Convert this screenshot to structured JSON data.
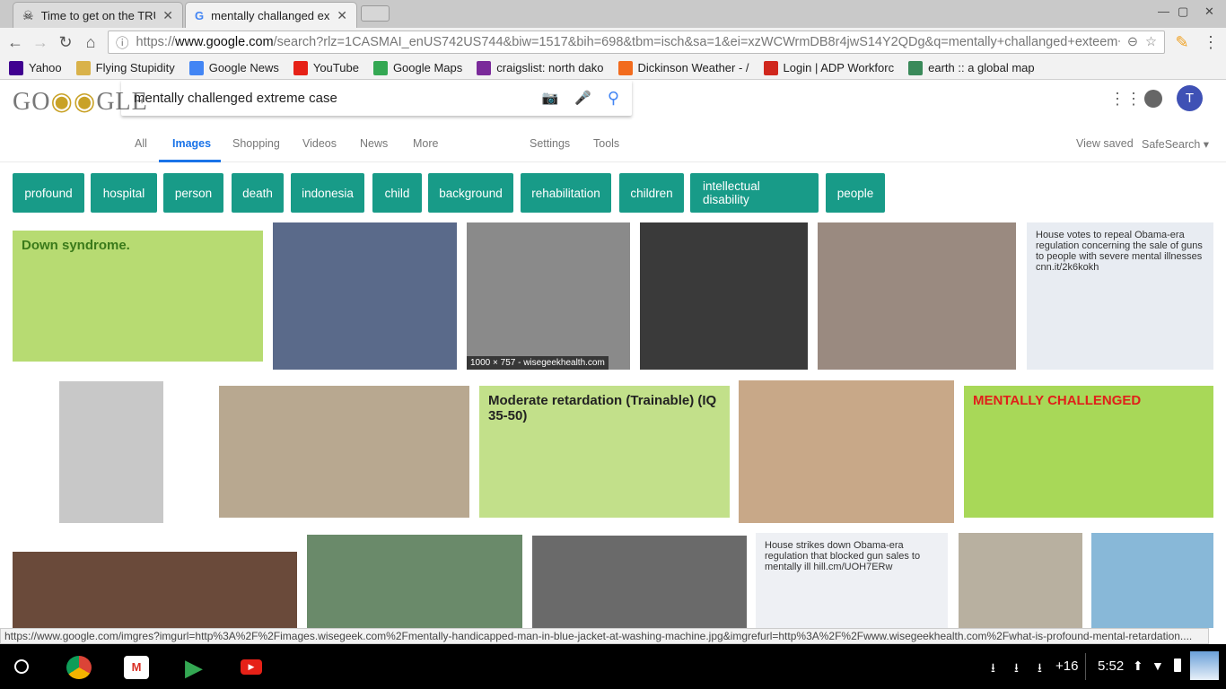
{
  "tabs": [
    {
      "title": "Time to get on the TRUM",
      "icon": "skull-crossbones-icon"
    },
    {
      "title": "mentally challanged exte",
      "icon": "google-g-icon"
    }
  ],
  "omnibox": {
    "scheme": "https://",
    "host": "www.google.com",
    "path": "/search?rlz=1CASMAI_enUS742US744&biw=1517&bih=698&tbm=isch&sa=1&ei=xzWCWrmDB8r4jwS14Y2QDg&q=mentally+challanged+exteem+cas..."
  },
  "bookmarks": [
    {
      "label": "Yahoo",
      "color": "#400090"
    },
    {
      "label": "Flying Stupidity",
      "color": "#d9b24a"
    },
    {
      "label": "Google News",
      "color": "#4285f4"
    },
    {
      "label": "YouTube",
      "color": "#e62117"
    },
    {
      "label": "Google Maps",
      "color": "#34a853"
    },
    {
      "label": "craigslist: north dako",
      "color": "#7a2a9a"
    },
    {
      "label": "Dickinson Weather - /",
      "color": "#f26b1d"
    },
    {
      "label": "Login | ADP Workforc",
      "color": "#d0271d"
    },
    {
      "label": "earth :: a global map",
      "color": "#3a8a5a"
    }
  ],
  "google": {
    "logo": "GOOGLE",
    "query": "mentally challenged extreme case",
    "account_initial": "T"
  },
  "nav": {
    "tabs": [
      "All",
      "Images",
      "Shopping",
      "Videos",
      "News",
      "More"
    ],
    "settings": "Settings",
    "tools": "Tools",
    "view_saved": "View saved",
    "safesearch": "SafeSearch ▾"
  },
  "chips": [
    "profound",
    "hospital",
    "person",
    "death",
    "indonesia",
    "child",
    "background",
    "rehabilitation",
    "children",
    "intellectual disability",
    "people"
  ],
  "images": [
    {
      "c": "#b7db72",
      "t": "Down syndrome.",
      "tc": "#3a7a1a"
    },
    {
      "c": "#5a6a8a",
      "t": ""
    },
    {
      "c": "#8a8a8a",
      "t": "",
      "cap": "1000 × 757 - wisegeekhealth.com"
    },
    {
      "c": "#3a3a3a",
      "t": ""
    },
    {
      "c": "#9a8a80",
      "t": ""
    },
    {
      "c": "#e8ecf2",
      "t": "House votes to repeal Obama-era regulation concerning the sale of guns to people with severe mental illnesses cnn.it/2k6kokh",
      "tc": "#333",
      "small": true
    },
    {
      "c": "#c8c8c8",
      "t": ""
    },
    {
      "c": "#b8a890",
      "t": ""
    },
    {
      "c": "#c2e08a",
      "t": "Moderate retardation (Trainable) (IQ 35-50)",
      "tc": "#222"
    },
    {
      "c": "#c8a888",
      "t": ""
    },
    {
      "c": "#a8d858",
      "t": "MENTALLY CHALLENGED",
      "tc": "#e0201a"
    },
    {
      "c": "#6a4a3a",
      "t": ""
    },
    {
      "c": "#6a8a6a",
      "t": ""
    },
    {
      "c": "#6a6a6a",
      "t": ""
    },
    {
      "c": "#eef0f4",
      "t": "House strikes down Obama-era regulation that blocked gun sales to mentally ill hill.cm/UOH7ERw",
      "tc": "#333",
      "small": true
    },
    {
      "c": "#b8b0a0",
      "t": ""
    },
    {
      "c": "#88b8d8",
      "t": ""
    }
  ],
  "status_url": "https://www.google.com/imgres?imgurl=http%3A%2F%2Fimages.wisegeek.com%2Fmentally-handicapped-man-in-blue-jacket-at-washing-machine.jpg&imgrefurl=http%3A%2F%2Fwww.wisegeekhealth.com%2Fwhat-is-profound-mental-retardation....",
  "shelf": {
    "downloads_more": "+16",
    "time": "5:52"
  }
}
